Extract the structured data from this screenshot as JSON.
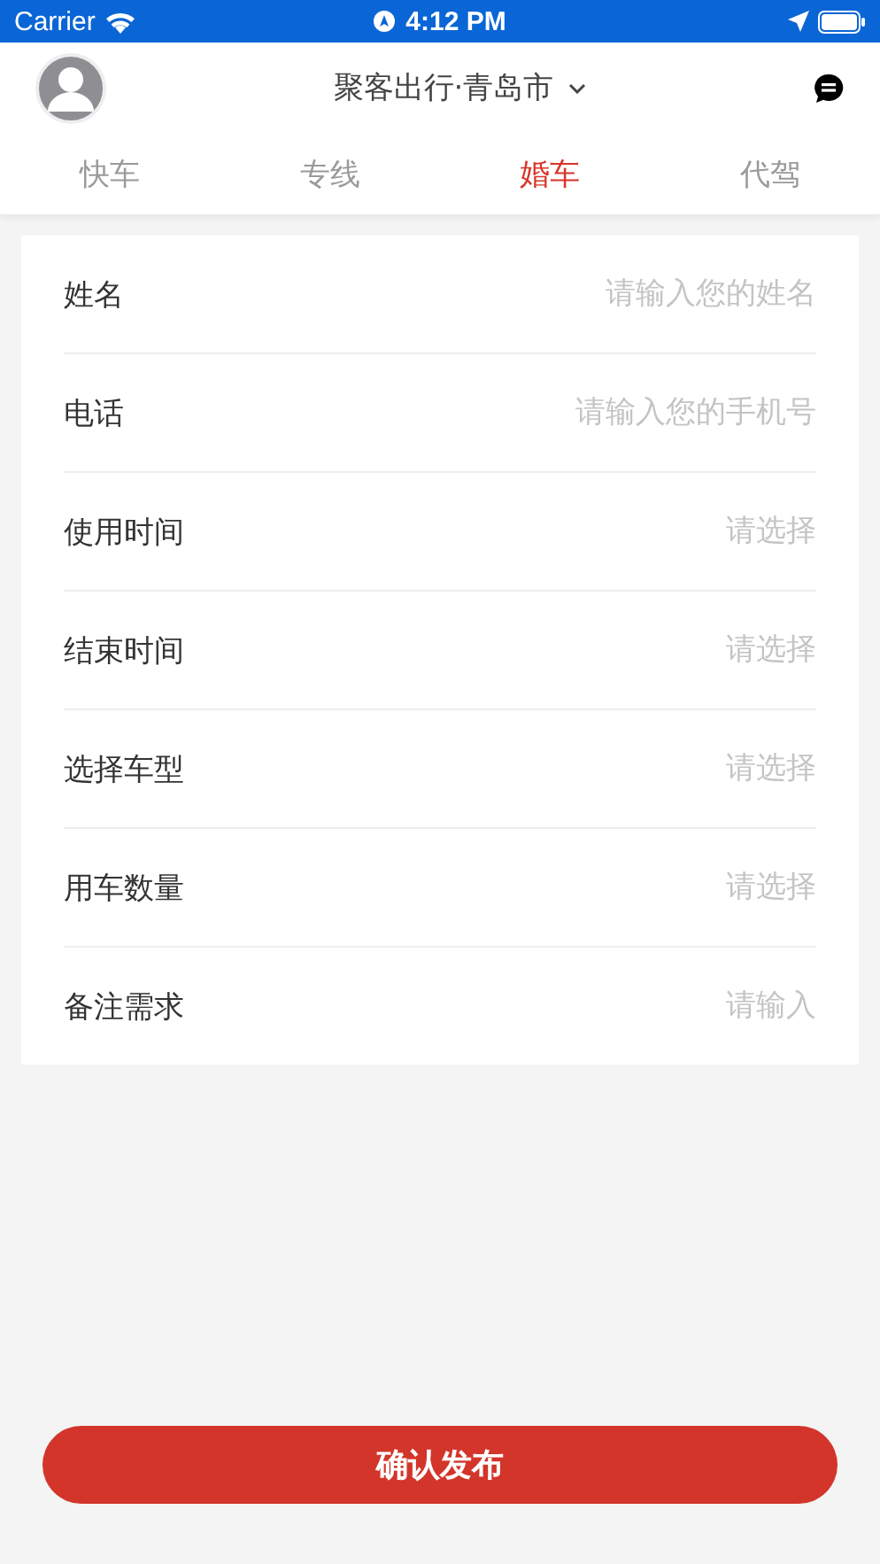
{
  "status_bar": {
    "carrier": "Carrier",
    "time": "4:12 PM"
  },
  "header": {
    "title": "聚客出行·青岛市"
  },
  "tabs": [
    {
      "label": "快车",
      "selected": false
    },
    {
      "label": "专线",
      "selected": false
    },
    {
      "label": "婚车",
      "selected": true
    },
    {
      "label": "代驾",
      "selected": false
    }
  ],
  "form": {
    "fields": [
      {
        "label": "姓名",
        "placeholder": "请输入您的姓名"
      },
      {
        "label": "电话",
        "placeholder": "请输入您的手机号"
      },
      {
        "label": "使用时间",
        "placeholder": "请选择"
      },
      {
        "label": "结束时间",
        "placeholder": "请选择"
      },
      {
        "label": "选择车型",
        "placeholder": "请选择"
      },
      {
        "label": "用车数量",
        "placeholder": "请选择"
      },
      {
        "label": "备注需求",
        "placeholder": "请输入"
      }
    ]
  },
  "submit_button": "确认发布"
}
